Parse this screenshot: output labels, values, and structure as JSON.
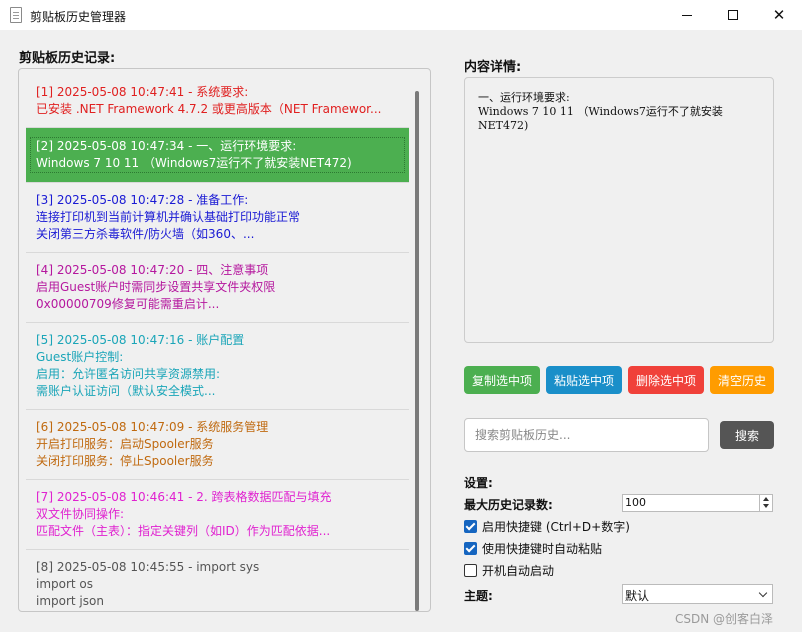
{
  "window": {
    "title": "剪贴板历史管理器",
    "icon": "document-icon"
  },
  "history": {
    "label": "剪贴板历史记录:",
    "items": [
      {
        "lines": [
          "[1] 2025-05-08 10:47:41 - 系统要求:",
          "已安装 .NET Framework 4.7.2 或更高版本（NET Framewor..."
        ],
        "color": "#e02020",
        "selected": false
      },
      {
        "lines": [
          "[2] 2025-05-08 10:47:34 - 一、运行环境要求:",
          "Windows 7 10 11 （Windows7运行不了就安装NET472)"
        ],
        "color": "#ffffff",
        "selected": true
      },
      {
        "lines": [
          "[3] 2025-05-08 10:47:28 - 准备工作:",
          "连接打印机到当前计算机并确认基础打印功能正常",
          "关闭第三方杀毒软件/防火墙（如360、..."
        ],
        "color": "#1a1ad4",
        "selected": false
      },
      {
        "lines": [
          "[4] 2025-05-08 10:47:20 - 四、注意事项",
          "启用Guest账户时需同步设置共享文件夹权限",
          "0x00000709修复可能需重启计..."
        ],
        "color": "#b5179e",
        "selected": false
      },
      {
        "lines": [
          "[5] 2025-05-08 10:47:16 - 账户配置",
          "Guest账户控制:",
          "启用：允许匿名访问共享资源禁用:",
          "需账户认证访问（默认安全模式..."
        ],
        "color": "#1aa5b8",
        "selected": false
      },
      {
        "lines": [
          "[6] 2025-05-08 10:47:09 - 系统服务管理",
          "开启打印服务：启动Spooler服务",
          "关闭打印服务：停止Spooler服务"
        ],
        "color": "#c06a10",
        "selected": false
      },
      {
        "lines": [
          "[7] 2025-05-08 10:46:41 - 2. 跨表格数据匹配与填充",
          "双文件协同操作:",
          "匹配文件（主表）：指定关键列（如ID）作为匹配依据..."
        ],
        "color": "#e022d0",
        "selected": false
      },
      {
        "lines": [
          "[8] 2025-05-08 10:45:55 - import sys",
          "import os",
          "import json"
        ],
        "color": "#555555",
        "selected": false
      }
    ]
  },
  "detail": {
    "label": "内容详情:",
    "content": "一、运行环境要求:\nWindows 7 10 11 （Windows7运行不了就安装\nNET472)"
  },
  "actions": {
    "copy": {
      "label": "复制选中项",
      "color": "#4caf50"
    },
    "paste": {
      "label": "粘贴选中项",
      "color": "#1a8fc9"
    },
    "delete": {
      "label": "删除选中项",
      "color": "#f0413a"
    },
    "clear": {
      "label": "清空历史",
      "color": "#ff9c00"
    }
  },
  "search": {
    "placeholder": "搜索剪贴板历史...",
    "value": "",
    "button_label": "搜索"
  },
  "settings": {
    "label": "设置:",
    "max_label": "最大历史记录数:",
    "max_value": "100",
    "hotkey": {
      "label": "启用快捷键 (Ctrl+D+数字)",
      "checked": true
    },
    "auto_paste": {
      "label": "使用快捷键时自动粘贴",
      "checked": true
    },
    "autostart": {
      "label": "开机自动启动",
      "checked": false
    },
    "theme_label": "主题:",
    "theme_value": "默认"
  },
  "watermark": "CSDN @创客白泽"
}
